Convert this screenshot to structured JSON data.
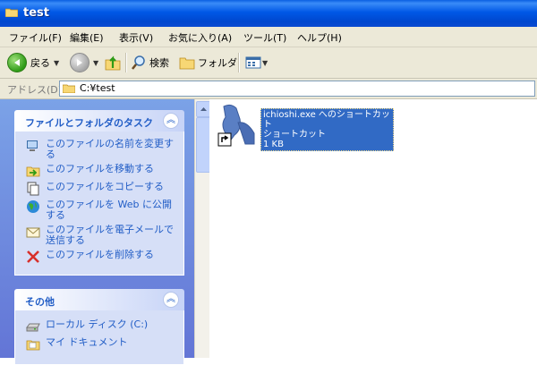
{
  "window": {
    "title": "test"
  },
  "menu": [
    "ファイル(F)",
    "編集(E)",
    "表示(V)",
    "お気に入り(A)",
    "ツール(T)",
    "ヘルプ(H)"
  ],
  "toolbar": {
    "back": "戻る",
    "search": "検索",
    "folders": "フォルダ"
  },
  "address": {
    "label": "アドレス(D)",
    "value": "C:¥test"
  },
  "tasks_panel": {
    "title": "ファイルとフォルダのタスク",
    "items": [
      "このファイルの名前を変更する",
      "このファイルを移動する",
      "このファイルをコピーする",
      "このファイルを Web に公開する",
      "このファイルを電子メールで送信する",
      "このファイルを削除する"
    ]
  },
  "other_panel": {
    "title": "その他",
    "items": [
      "ローカル ディスク (C:)",
      "マイ ドキュメント"
    ]
  },
  "file": {
    "name": "ichioshi.exe へのショートカット",
    "type": "ショートカット",
    "size": "1 KB"
  },
  "colors": {
    "title_bar": "#0054e3",
    "task_link": "#215dc6",
    "selection": "#316ac5"
  }
}
